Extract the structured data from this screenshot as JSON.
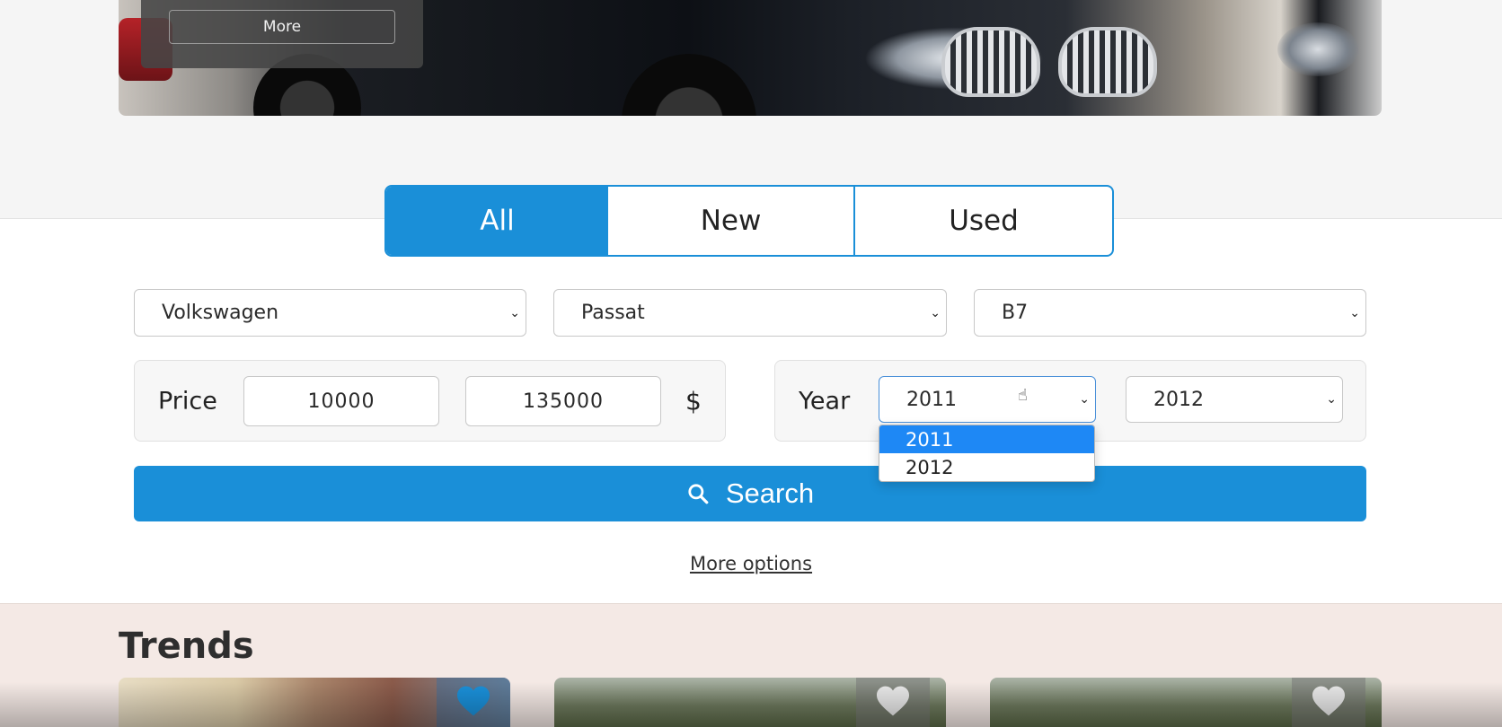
{
  "hero": {
    "more_label": "More"
  },
  "condition_tabs": {
    "all": "All",
    "new": "New",
    "used": "Used",
    "active": "All"
  },
  "filters": {
    "make": "Volkswagen",
    "model": "Passat",
    "generation": "B7",
    "price": {
      "label": "Price",
      "min": "10000",
      "max": "135000",
      "currency": "$"
    },
    "year": {
      "label": "Year",
      "from": "2011",
      "to": "2012",
      "dropdown_options": [
        "2011",
        "2012"
      ],
      "highlighted_option": "2011"
    }
  },
  "search": {
    "label": "Search",
    "icon": "search-icon"
  },
  "more_options": "More options",
  "trends": {
    "title": "Trends",
    "cards": [
      {
        "favorite": true
      },
      {
        "favorite": false
      },
      {
        "favorite": false
      }
    ]
  },
  "colors": {
    "accent": "#1a8fd8",
    "dropdown_highlight": "#1e88f5",
    "trends_bg": "#f4e9e5"
  }
}
